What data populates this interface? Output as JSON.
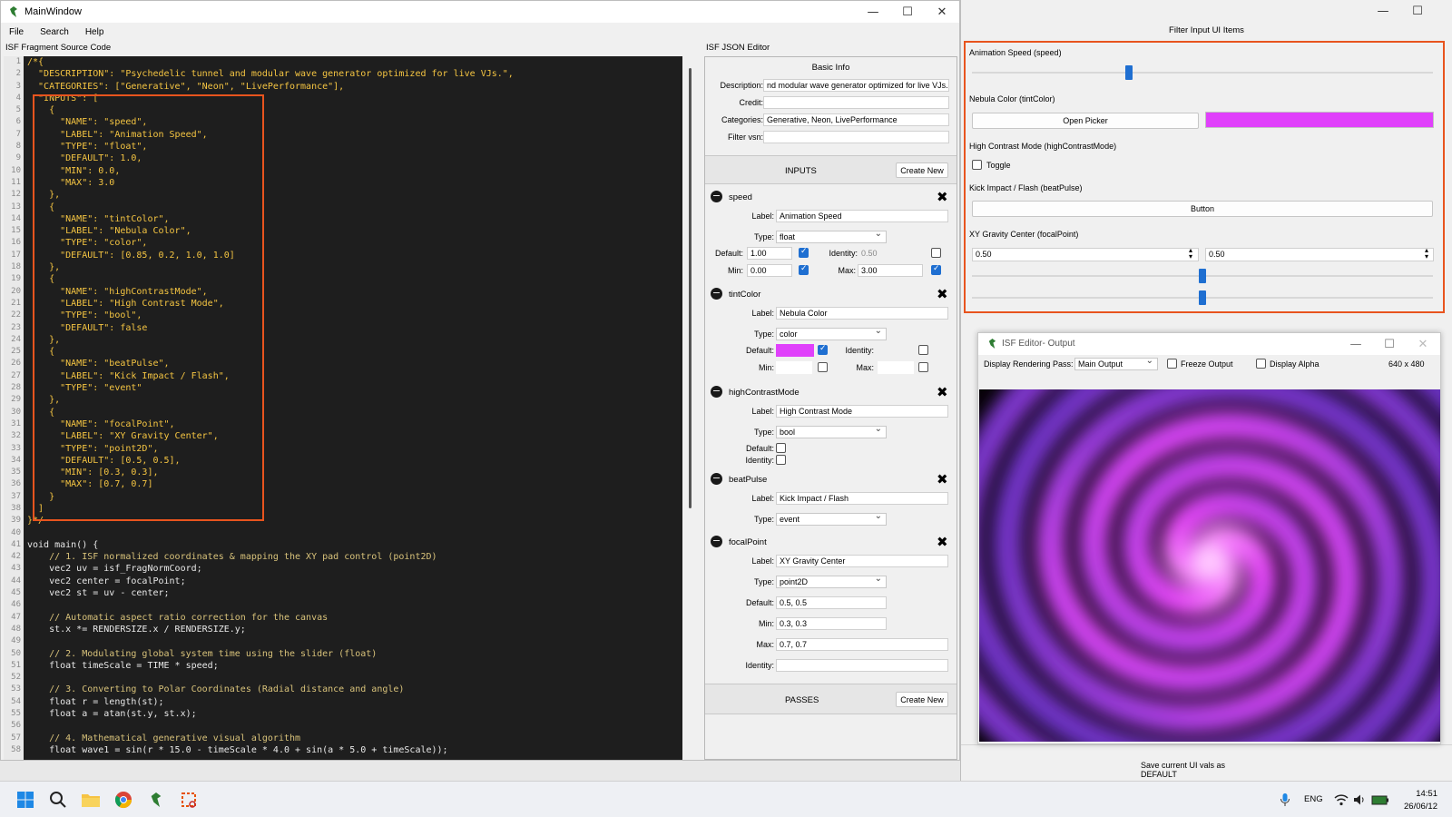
{
  "main_window": {
    "title": "MainWindow",
    "menu": [
      "File",
      "Search",
      "Help"
    ],
    "source_label": "ISF Fragment Source Code",
    "json_label": "ISF JSON Editor"
  },
  "code": {
    "lines": [
      "/*{",
      "  \"DESCRIPTION\": \"Psychedelic tunnel and modular wave generator optimized for live VJs.\",",
      "  \"CATEGORIES\": [\"Generative\", \"Neon\", \"LivePerformance\"],",
      "  \"INPUTS\": [",
      "    {",
      "      \"NAME\": \"speed\",",
      "      \"LABEL\": \"Animation Speed\",",
      "      \"TYPE\": \"float\",",
      "      \"DEFAULT\": 1.0,",
      "      \"MIN\": 0.0,",
      "      \"MAX\": 3.0",
      "    },",
      "    {",
      "      \"NAME\": \"tintColor\",",
      "      \"LABEL\": \"Nebula Color\",",
      "      \"TYPE\": \"color\",",
      "      \"DEFAULT\": [0.85, 0.2, 1.0, 1.0]",
      "    },",
      "    {",
      "      \"NAME\": \"highContrastMode\",",
      "      \"LABEL\": \"High Contrast Mode\",",
      "      \"TYPE\": \"bool\",",
      "      \"DEFAULT\": false",
      "    },",
      "    {",
      "      \"NAME\": \"beatPulse\",",
      "      \"LABEL\": \"Kick Impact / Flash\",",
      "      \"TYPE\": \"event\"",
      "    },",
      "    {",
      "      \"NAME\": \"focalPoint\",",
      "      \"LABEL\": \"XY Gravity Center\",",
      "      \"TYPE\": \"point2D\",",
      "      \"DEFAULT\": [0.5, 0.5],",
      "      \"MIN\": [0.3, 0.3],",
      "      \"MAX\": [0.7, 0.7]",
      "    }",
      "  ]",
      "}*/",
      "",
      "void main() {",
      "    // 1. ISF normalized coordinates & mapping the XY pad control (point2D)",
      "    vec2 uv = isf_FragNormCoord;",
      "    vec2 center = focalPoint;",
      "    vec2 st = uv - center;",
      "",
      "    // Automatic aspect ratio correction for the canvas",
      "    st.x *= RENDERSIZE.x / RENDERSIZE.y;",
      "",
      "    // 2. Modulating global system time using the slider (float)",
      "    float timeScale = TIME * speed;",
      "",
      "    // 3. Converting to Polar Coordinates (Radial distance and angle)",
      "    float r = length(st);",
      "    float a = atan(st.y, st.x);",
      "",
      "    // 4. Mathematical generative visual algorithm",
      "    float wave1 = sin(r * 15.0 - timeScale * 4.0 + sin(a * 5.0 + timeScale));"
    ],
    "line_numbers": [
      "1",
      "2",
      "3",
      "4",
      "5",
      "6",
      "7",
      "8",
      "9",
      "10",
      "11",
      "12",
      "13",
      "14",
      "15",
      "16",
      "17",
      "18",
      "19",
      "20",
      "21",
      "22",
      "23",
      "24",
      "25",
      "26",
      "27",
      "28",
      "29",
      "30",
      "31",
      "32",
      "33",
      "34",
      "35",
      "36",
      "37",
      "38",
      "39",
      "40",
      "41",
      "42",
      "43",
      "44",
      "45",
      "46",
      "47",
      "48",
      "49",
      "50",
      "51",
      "52",
      "53",
      "54",
      "55",
      "56",
      "57",
      "58"
    ]
  },
  "json_editor": {
    "basic_info_title": "Basic Info",
    "description_label": "Description:",
    "description_value": "nd modular wave generator optimized for live VJs.",
    "credit_label": "Credit:",
    "credit_value": "",
    "categories_label": "Categories:",
    "categories_value": "Generative, Neon, LivePerformance",
    "filter_vsn_label": "Filter vsn:",
    "filter_vsn_value": "",
    "inputs_title": "INPUTS",
    "create_new": "Create New",
    "passes_title": "PASSES",
    "field_labels": {
      "label": "Label:",
      "type": "Type:",
      "default": "Default:",
      "identity": "Identity:",
      "min": "Min:",
      "max": "Max:"
    },
    "inputs": [
      {
        "name": "speed",
        "label": "Animation Speed",
        "type": "float",
        "default": "1.00",
        "identity": "0.50",
        "min": "0.00",
        "max": "3.00"
      },
      {
        "name": "tintColor",
        "label": "Nebula Color",
        "type": "color",
        "default_color": "#e040fb"
      },
      {
        "name": "highContrastMode",
        "label": "High Contrast Mode",
        "type": "bool"
      },
      {
        "name": "beatPulse",
        "label": "Kick Impact / Flash",
        "type": "event"
      },
      {
        "name": "focalPoint",
        "label": "XY Gravity Center",
        "type": "point2D",
        "default": "0.5, 0.5",
        "min": "0.3, 0.3",
        "max": "0.7, 0.7",
        "identity": ""
      }
    ]
  },
  "filter_window": {
    "title": "Filter Input UI Items",
    "speed_label": "Animation Speed (speed)",
    "speed_value_fraction": 0.34,
    "tint_label": "Nebula Color (tintColor)",
    "open_picker": "Open Picker",
    "tint_color": "#e040fb",
    "contrast_label": "High Contrast Mode (highContrastMode)",
    "toggle_label": "Toggle",
    "kick_label": "Kick Impact / Flash (beatPulse)",
    "button_label": "Button",
    "xy_label": "XY Gravity Center (focalPoint)",
    "xy_x": "0.50",
    "xy_y": "0.50",
    "save_default": "Save current UI vals as DEFAULT"
  },
  "output_window": {
    "title": "ISF Editor- Output",
    "pass_label": "Display Rendering Pass:",
    "pass_value": "Main Output",
    "freeze_label": "Freeze Output",
    "alpha_label": "Display Alpha",
    "resolution": "640 x 480"
  },
  "taskbar": {
    "lang": "ENG",
    "time": "14:51",
    "date": "26/06/12"
  },
  "colors": {
    "accent": "#1f6fd1",
    "highlight_border": "#e8541e",
    "swatch": "#e040fb"
  }
}
